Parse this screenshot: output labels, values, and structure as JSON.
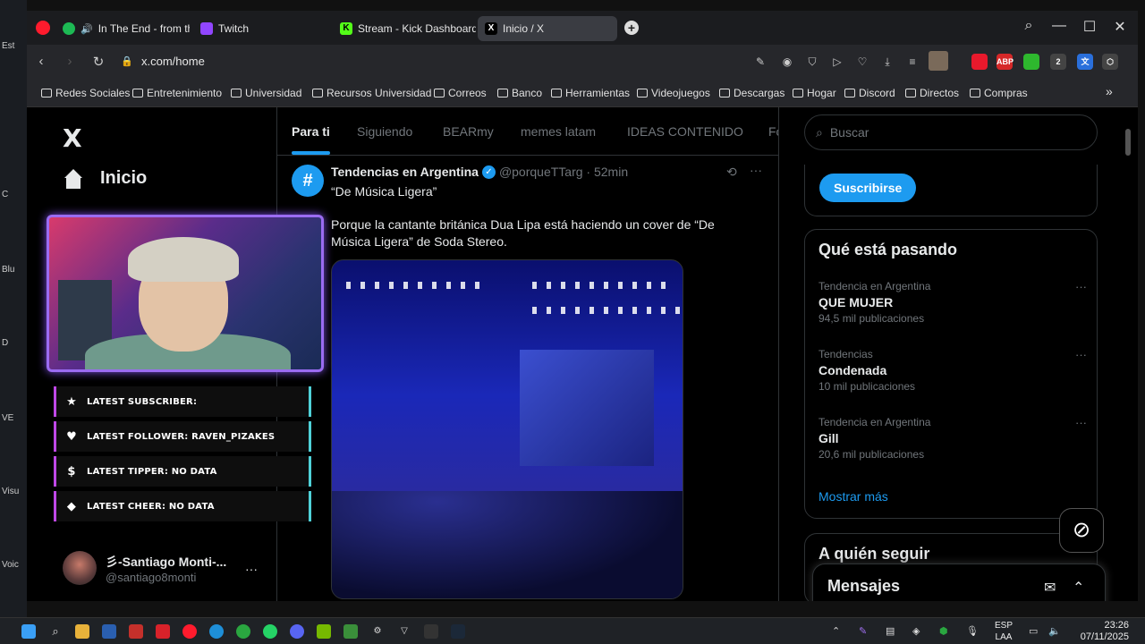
{
  "desktop": {
    "labels": [
      "Est",
      "C",
      "Blu",
      "D",
      "VE",
      "Visu",
      "Voic"
    ]
  },
  "browser": {
    "tabs": [
      {
        "label": "In The End - from the",
        "icon": "spotify-icon",
        "color": "#1db954"
      },
      {
        "label": "Twitch",
        "icon": "twitch-icon",
        "color": "#9146ff"
      },
      {
        "label": "Stream - Kick Dashboard",
        "icon": "kick-icon",
        "color": "#53fc18"
      },
      {
        "label": "Inicio / X",
        "icon": "x-icon",
        "color": "#000000"
      }
    ],
    "new_tab": "+",
    "url": "x.com/home",
    "bookmarks": [
      "Redes Sociales",
      "Entretenimiento",
      "Universidad",
      "Recursos Universidad",
      "Correos",
      "Banco",
      "Herramientas",
      "Videojuegos",
      "Descargas",
      "Hogar",
      "Discord",
      "Directos",
      "Compras"
    ],
    "bookmarks_more": "»"
  },
  "x": {
    "logo": "X",
    "nav": {
      "home_label": "Inicio"
    },
    "tabs": [
      "Para ti",
      "Siguiendo",
      "BEARmy",
      "memes latam",
      "IDEAS CONTENIDO",
      "Fo"
    ],
    "post": {
      "avatar_glyph": "#",
      "name": "Tendencias en Argentina",
      "handle": "@porqueTTarg · 52min",
      "quote": "“De Música Ligera”",
      "text": "Porque la cantante británica Dua Lipa está haciendo un cover de “De Música Ligera” de Soda Stereo."
    },
    "search_placeholder": "Buscar",
    "subscribe_label": "Suscribirse",
    "trends_title": "Qué está pasando",
    "trends": [
      {
        "context": "Tendencia en Argentina",
        "name": "QUE MUJER",
        "count": "94,5 mil publicaciones"
      },
      {
        "context": "Tendencias",
        "name": "Condenada",
        "count": "10 mil publicaciones"
      },
      {
        "context": "Tendencia en Argentina",
        "name": "Gill",
        "count": "20,6 mil publicaciones"
      }
    ],
    "show_more": "Mostrar más",
    "who_to_follow": "A quién seguir",
    "messages": "Mensajes",
    "user": {
      "name": "彡-Santiago Monti-...",
      "handle": "@santiago8monti"
    }
  },
  "stream_overlay": {
    "alerts": [
      {
        "icon": "star-icon",
        "glyph": "★",
        "label": "LATEST SUBSCRIBER:"
      },
      {
        "icon": "heart-icon",
        "glyph": "♥",
        "label": "LATEST FOLLOWER: RAVEN_PIZAKES"
      },
      {
        "icon": "dollar-icon",
        "glyph": "$",
        "label": "LATEST TIPPER: NO DATA"
      },
      {
        "icon": "diamond-icon",
        "glyph": "◆",
        "label": "LATEST CHEER: NO DATA"
      }
    ]
  },
  "taskbar": {
    "language": "ESP",
    "layout": "LAA",
    "time": "23:26",
    "date": "07/11/2025"
  }
}
